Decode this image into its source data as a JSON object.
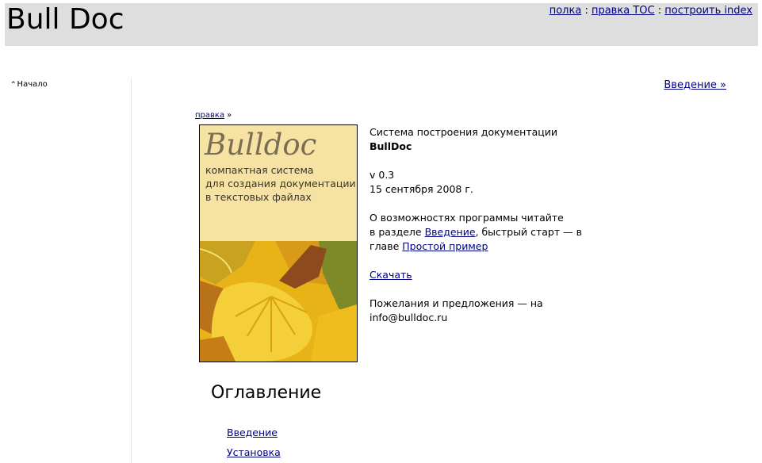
{
  "header": {
    "title": "Bull Doc",
    "links": [
      "полка",
      "правка TOC",
      "построить index"
    ],
    "separator": ":"
  },
  "sidebar": {
    "home_label": "Начало"
  },
  "nav": {
    "next_label": "Введение »"
  },
  "breadcrumb": {
    "link": "правка",
    "arrow": "»"
  },
  "cover": {
    "title": "Bulldoc",
    "subtitle_lines": [
      "компактная система",
      "для создания документации",
      "в текстовых файлах"
    ],
    "colors": {
      "top": "#f6e3a3",
      "leaves": "#e8b316"
    }
  },
  "info": {
    "line1": "Система построения документации",
    "product": "BullDoc",
    "version": "v 0.3",
    "date": "15 сентября 2008 г.",
    "about_1": "О возможностях программы читайте",
    "about_2": "в разделе ",
    "about_link1": "Введение",
    "about_3": ", быстрый старт — в",
    "about_4": "главе ",
    "about_link2": "Простой пример",
    "download": "Скачать",
    "wishes": "Пожелания и предложения — на",
    "email": "info@bulldoc.ru"
  },
  "toc": {
    "title": "Оглавление",
    "items": [
      "Введение",
      "Установка"
    ]
  },
  "colors": {
    "header_bg": "#dedede",
    "link": "#000080"
  }
}
